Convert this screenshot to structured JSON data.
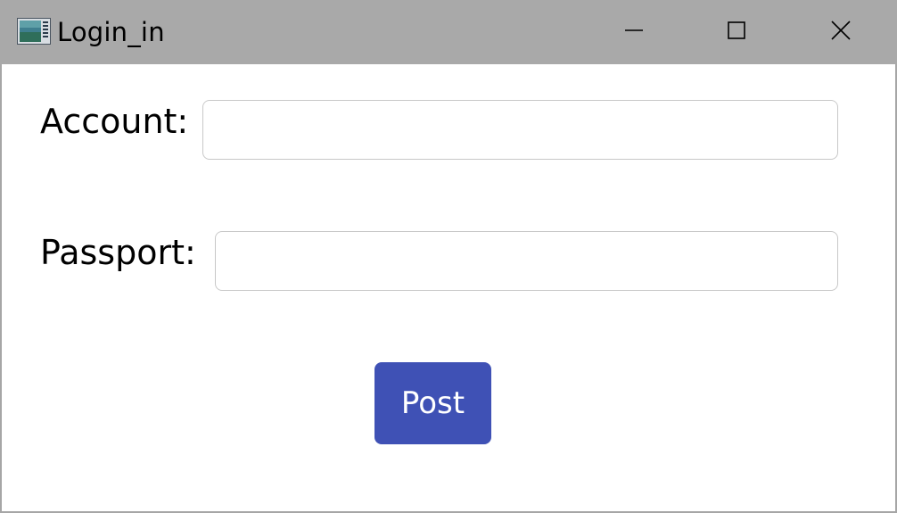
{
  "window": {
    "title": "Login_in",
    "app_icon": "application-window-icon",
    "controls": {
      "minimize_icon": "minimize-icon",
      "maximize_icon": "maximize-icon",
      "close_icon": "close-icon"
    }
  },
  "form": {
    "account": {
      "label": "Account:",
      "value": "",
      "placeholder": ""
    },
    "passport": {
      "label": "Passport:",
      "value": "",
      "placeholder": ""
    },
    "submit": {
      "label": "Post"
    }
  },
  "colors": {
    "titlebar": "#a9a9a9",
    "accent": "#3f51b5",
    "background": "#ffffff"
  }
}
